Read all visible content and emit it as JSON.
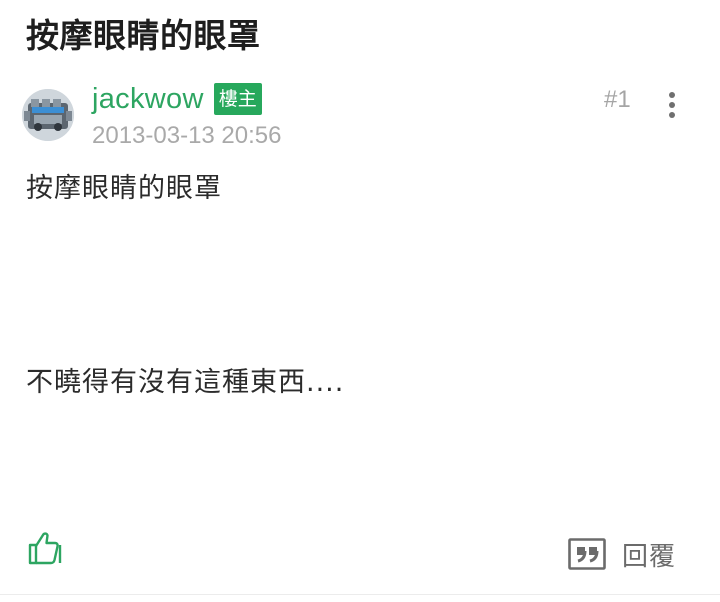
{
  "thread": {
    "title": "按摩眼睛的眼罩"
  },
  "post": {
    "author": {
      "name": "jackwow",
      "badge": "樓主",
      "avatar": "avatar-engine-image"
    },
    "timestamp": "2013-03-13 20:56",
    "floor": "#1",
    "body": {
      "line1": "按摩眼睛的眼罩",
      "line2": "不曉得有沒有這種東西...."
    },
    "actions": {
      "like_icon": "thumbs-up-icon",
      "reply_icon": "quote-icon",
      "reply_label": "回覆",
      "more_icon": "more-vertical-icon"
    }
  },
  "colors": {
    "accent": "#2da561",
    "badge_bg": "#27a85c",
    "meta_text": "#a9a9a9"
  }
}
